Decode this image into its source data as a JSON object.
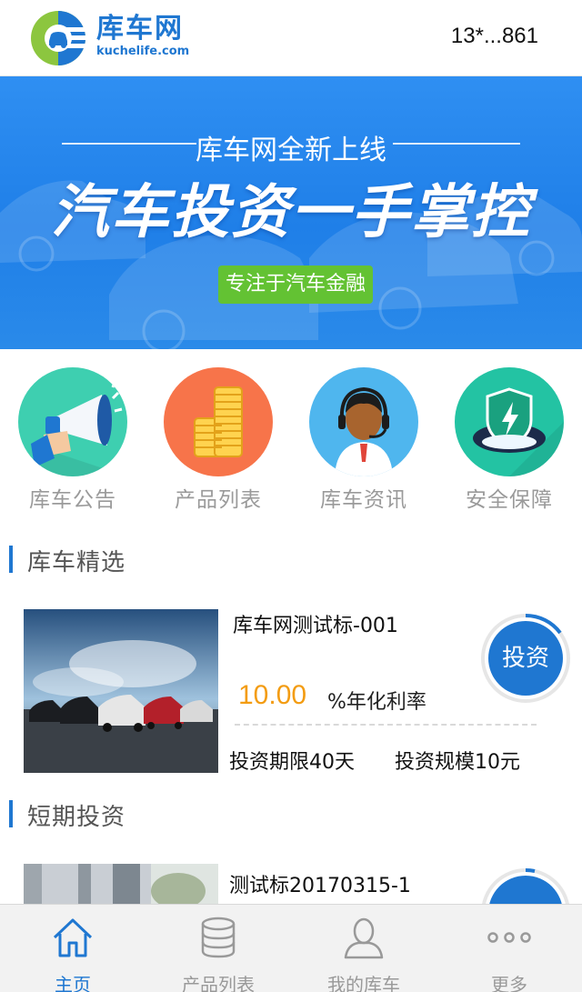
{
  "header": {
    "logo_cn": "库车网",
    "logo_en": "kuchelife.com",
    "user_phone": "13*...861"
  },
  "banner": {
    "subtitle": "库车网全新上线",
    "title": "汽车投资一手掌控",
    "button": "专注于汽车金融"
  },
  "quick_links": [
    {
      "label": "库车公告",
      "icon": "megaphone-icon",
      "color": "#3ecfb0"
    },
    {
      "label": "产品列表",
      "icon": "coins-icon",
      "color": "#f7744a"
    },
    {
      "label": "库车资讯",
      "icon": "customer-service-icon",
      "color": "#4fb6ee"
    },
    {
      "label": "安全保障",
      "icon": "shield-icon",
      "color": "#23c3a3"
    }
  ],
  "sections": {
    "featured": "库车精选",
    "short_term": "短期投资"
  },
  "products": [
    {
      "name": "库车网测试标-001",
      "rate": "10.00",
      "rate_label": "%年化利率",
      "term": "投资期限40天",
      "scale": "投资规模10元",
      "button": "投资"
    },
    {
      "name": "测试标20170315-1"
    }
  ],
  "tabbar": [
    {
      "label": "主页",
      "icon": "home-icon",
      "active": true
    },
    {
      "label": "产品列表",
      "icon": "database-icon",
      "active": false
    },
    {
      "label": "我的库车",
      "icon": "user-icon",
      "active": false
    },
    {
      "label": "更多",
      "icon": "more-dots-icon",
      "active": false
    }
  ],
  "colors": {
    "brand_blue": "#1f77d1",
    "rate_orange": "#f39c12",
    "banner_button_green": "#63c233"
  }
}
